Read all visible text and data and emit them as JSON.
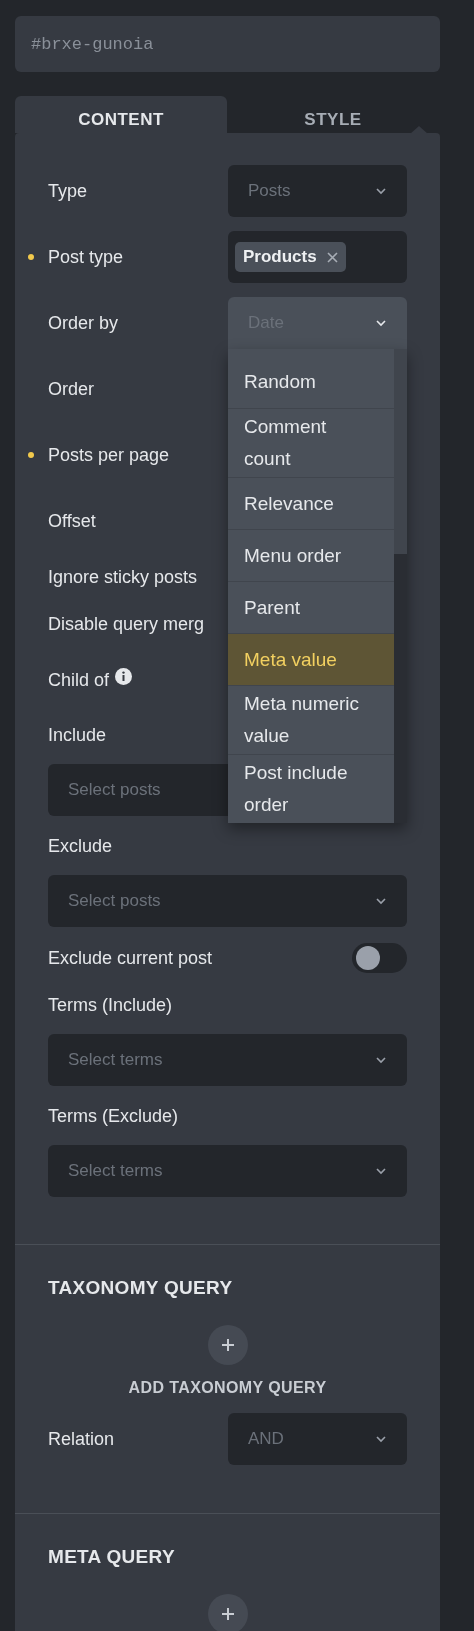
{
  "element_id": "#brxe-gunoia",
  "tabs": [
    {
      "label": "CONTENT",
      "selected": true
    },
    {
      "label": "STYLE",
      "selected": false
    }
  ],
  "fields": [
    {
      "kind": "select",
      "label": "Type",
      "placeholder": "Posts",
      "modified": false
    },
    {
      "kind": "tags",
      "label": "Post type",
      "tags": [
        "Products"
      ],
      "modified": true
    },
    {
      "kind": "select",
      "label": "Order by",
      "placeholder": "Date",
      "open": true,
      "modified": false
    },
    {
      "kind": "plain",
      "label": "Order",
      "modified": false
    },
    {
      "kind": "plain",
      "label": "Posts per page",
      "modified": true
    },
    {
      "kind": "plain",
      "label": "Offset",
      "modified": false
    },
    {
      "kind": "short",
      "label": "Ignore sticky posts",
      "modified": false
    },
    {
      "kind": "short",
      "label": "Disable query merg",
      "modified": false
    },
    {
      "kind": "info",
      "label": "Child of",
      "modified": false
    },
    {
      "kind": "stacked",
      "label": "Include",
      "placeholder": "Select posts",
      "chevron": false,
      "modified": false
    },
    {
      "kind": "stacked",
      "label": "Exclude",
      "placeholder": "Select posts",
      "chevron": true,
      "modified": false
    },
    {
      "kind": "toggle",
      "label": "Exclude current post",
      "on": false,
      "modified": false
    },
    {
      "kind": "stacked",
      "label": "Terms (Include)",
      "placeholder": "Select terms",
      "chevron": true,
      "modified": false
    },
    {
      "kind": "stacked",
      "label": "Terms (Exclude)",
      "placeholder": "Select terms",
      "chevron": true,
      "modified": false
    }
  ],
  "order_by_menu": [
    {
      "label": "Random",
      "selected": false
    },
    {
      "label": "Comment count",
      "selected": false
    },
    {
      "label": "Relevance",
      "selected": false
    },
    {
      "label": "Menu order",
      "selected": false
    },
    {
      "label": "Parent",
      "selected": false
    },
    {
      "label": "Meta value",
      "selected": true
    },
    {
      "label": "Meta numeric value",
      "selected": false
    },
    {
      "label": "Post include order",
      "selected": false
    }
  ],
  "taxonomy_query": {
    "title": "TAXONOMY QUERY",
    "add_label": "ADD TAXONOMY QUERY",
    "relation": {
      "label": "Relation",
      "placeholder": "AND"
    }
  },
  "meta_query": {
    "title": "META QUERY"
  }
}
